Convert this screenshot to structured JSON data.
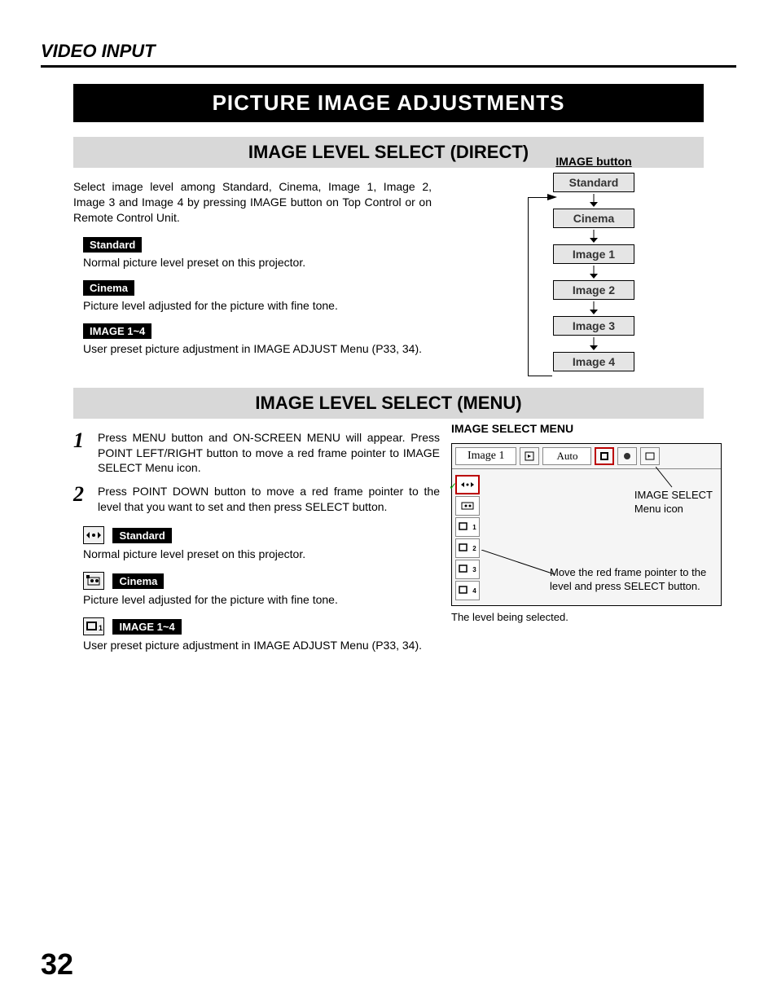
{
  "header": {
    "section": "VIDEO INPUT"
  },
  "banner": {
    "title": "PICTURE IMAGE ADJUSTMENTS"
  },
  "direct": {
    "title": "IMAGE LEVEL SELECT (DIRECT)",
    "intro": "Select image level among Standard, Cinema, Image 1, Image 2, Image 3 and Image 4 by pressing IMAGE button on Top Control or on Remote Control Unit.",
    "items": [
      {
        "label": "Standard",
        "desc": "Normal picture level preset on this projector."
      },
      {
        "label": "Cinema",
        "desc": "Picture level adjusted for the picture with fine tone."
      },
      {
        "label": "IMAGE 1~4",
        "desc": "User preset picture adjustment in IMAGE ADJUST Menu (P33, 34)."
      }
    ],
    "diagram": {
      "title": "IMAGE button",
      "boxes": [
        "Standard",
        "Cinema",
        "Image 1",
        "Image 2",
        "Image 3",
        "Image 4"
      ]
    }
  },
  "menu": {
    "title": "IMAGE LEVEL SELECT (MENU)",
    "steps": [
      {
        "num": "1",
        "text": "Press MENU button and ON-SCREEN MENU will appear.  Press POINT LEFT/RIGHT button to move a red frame pointer to IMAGE SELECT Menu icon."
      },
      {
        "num": "2",
        "text": "Press POINT DOWN button to move a red frame pointer to the level that you want to set and then press SELECT button."
      }
    ],
    "items": [
      {
        "label": "Standard",
        "desc": "Normal picture level preset on this projector."
      },
      {
        "label": "Cinema",
        "desc": "Picture level adjusted for the picture with fine tone."
      },
      {
        "label": "IMAGE 1~4",
        "desc": "User preset picture adjustment in IMAGE ADJUST Menu (P33, 34)."
      }
    ],
    "panel": {
      "title": "IMAGE SELECT MENU",
      "topLabel": "Image 1",
      "auto": "Auto",
      "callout1a": "IMAGE SELECT",
      "callout1b": "Menu icon",
      "callout2": "Move the red frame pointer to the level and press SELECT button.",
      "caption": "The level being selected."
    }
  },
  "page": "32"
}
